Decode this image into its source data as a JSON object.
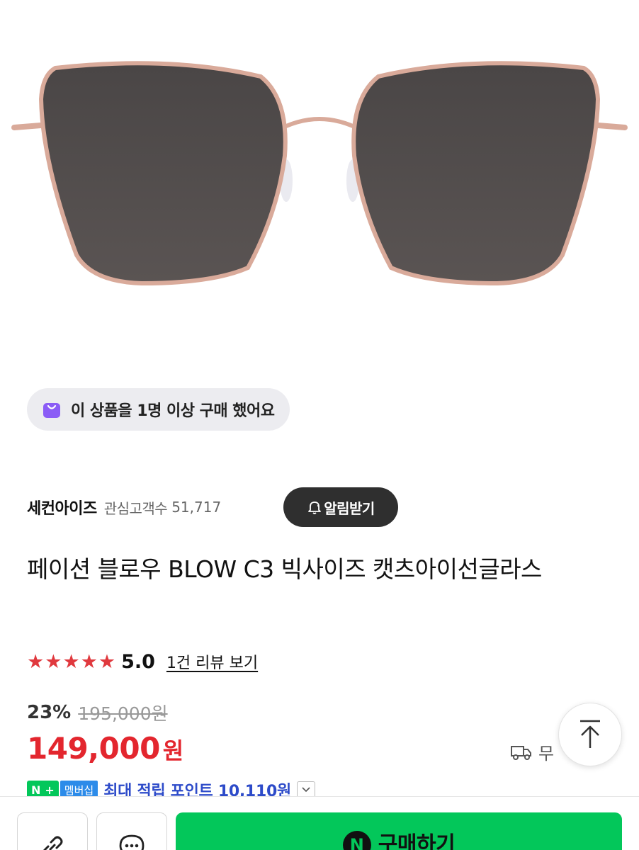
{
  "product": {
    "buyer_badge": "이 상품을 1명 이상 구매 했어요",
    "store_name": "세컨아이즈",
    "followers_label": "관심고객수",
    "followers_count": "51,717",
    "alert_button": "알림받기",
    "title": "페이션 블로우 BLOW C3 빅사이즈 캣츠아이선글라스",
    "rating": {
      "stars": 5,
      "star_glyph": "★",
      "value": "5.0",
      "review_link": "1건 리뷰 보기"
    },
    "discount_percent": "23%",
    "original_price": "195,000원",
    "price": "149,000",
    "price_unit": "원",
    "shipping_text": "무",
    "points": {
      "n_badge": "N",
      "plus": "+",
      "membership": "멤버십",
      "text": "최대 적립 포인트 10,110원"
    }
  },
  "bottom_bar": {
    "buy_label": "구매하기",
    "npay_glyph": "N"
  },
  "colors": {
    "accent_green": "#03c75a",
    "price_red": "#e3262e",
    "star_red": "#e0393e",
    "badge_purple": "#8b5cf6"
  },
  "icons": [
    "bag-icon",
    "bell-icon",
    "star-icon",
    "truck-icon",
    "arrow-up-icon",
    "link-icon",
    "chat-icon",
    "npay-icon",
    "chevron-down-icon"
  ]
}
